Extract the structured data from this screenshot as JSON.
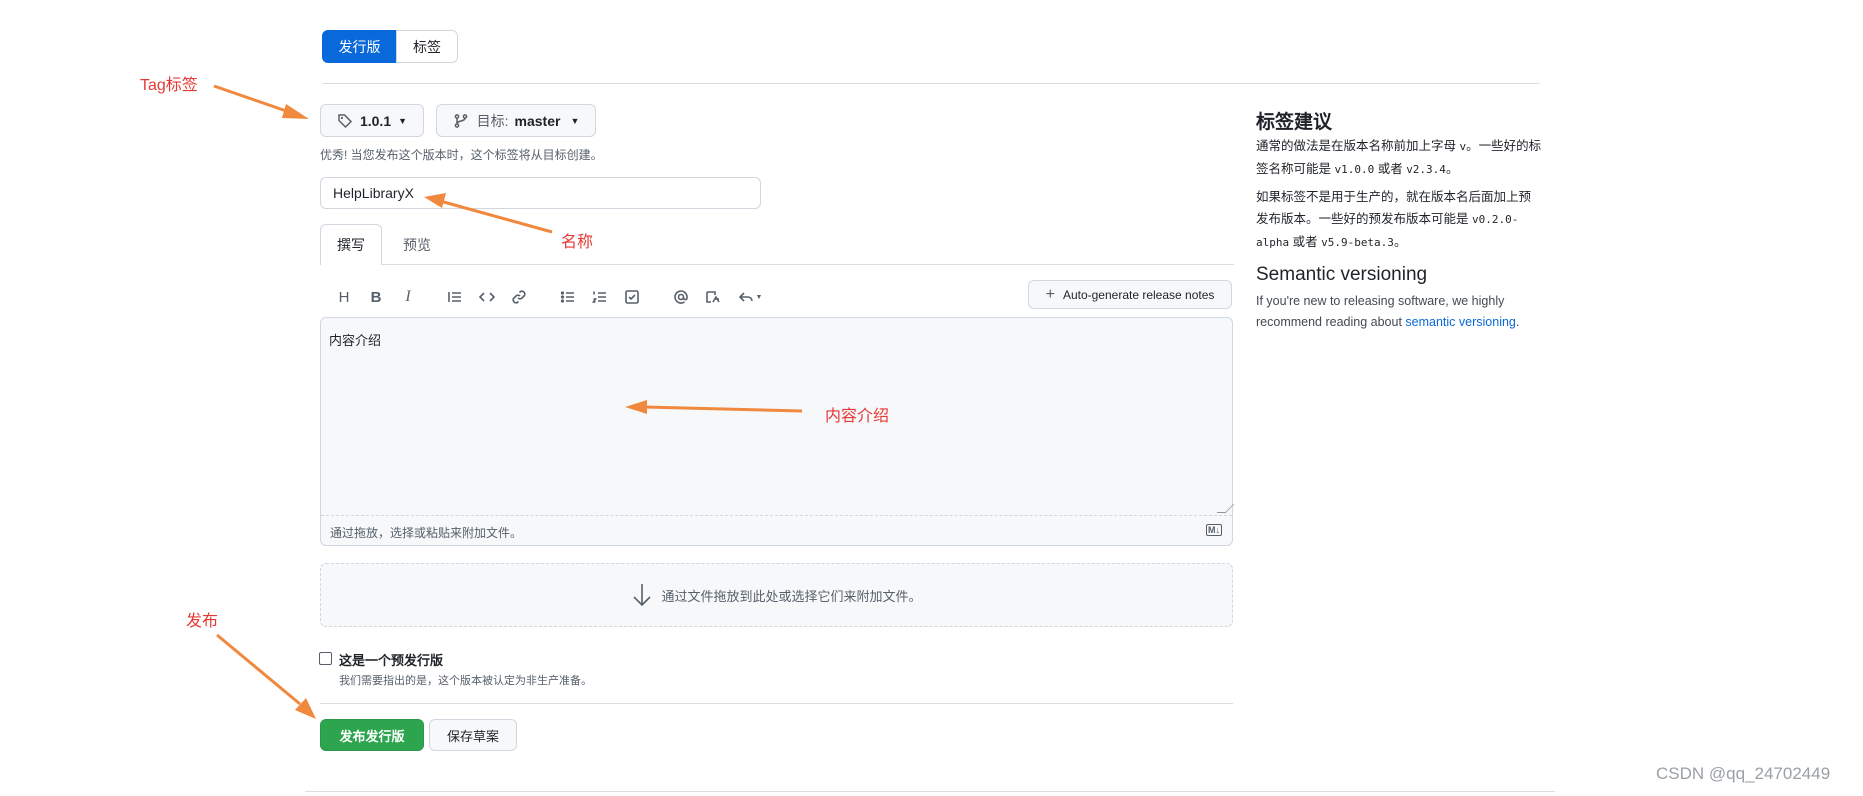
{
  "tabs": {
    "release_label": "发行版",
    "tags_label": "标签"
  },
  "form": {
    "tag_value": "1.0.1",
    "target_prefix": "目标:",
    "target_value": "master",
    "tag_hint": "优秀! 当您发布这个版本时，这个标签将从目标创建。",
    "title_value": "HelpLibraryX",
    "editor_tabs": {
      "write": "撰写",
      "preview": "预览"
    },
    "auto_generate_label": "Auto-generate release notes",
    "body_value": "内容介绍",
    "attach_hint": "通过拖放，选择或粘贴来附加文件。",
    "md_badge": "M↓",
    "dropzone_text": "通过文件拖放到此处或选择它们来附加文件。",
    "prerelease_label": "这是一个预发行版",
    "prerelease_desc": "我们需要指出的是，这个版本被认定为非生产准备。",
    "publish_label": "发布发行版",
    "draft_label": "保存草案"
  },
  "sidebar": {
    "tag_heading": "标签建议",
    "tag_p1_a": "通常的做法是在版本名称前加上字母 ",
    "tag_p1_code1": "v",
    "tag_p1_b": "。一些好的标签名称可能是 ",
    "tag_p1_code2": "v1.0.0",
    "tag_p1_c": " 或者 ",
    "tag_p1_code3": "v2.3.4",
    "tag_p1_d": "。",
    "tag_p2_a": "如果标签不是用于生产的，就在版本名后面加上预发布版本。一些好的预发布版本可能是 ",
    "tag_p2_code1": "v0.2.0-alpha",
    "tag_p2_b": " 或者 ",
    "tag_p2_code2": "v5.9-beta.3",
    "tag_p2_c": "。",
    "semver_heading": "Semantic versioning",
    "semver_text": "If you're new to releasing software, we highly recommend reading about ",
    "semver_link": "semantic versioning",
    "semver_end": "."
  },
  "annotations": {
    "tag": "Tag标签",
    "name": "名称",
    "content": "内容介绍",
    "publish": "发布"
  },
  "watermark": "CSDN @qq_24702449",
  "colors": {
    "primary_blue": "#0969da",
    "publish_green": "#2da44e",
    "annotation_red": "#e53935",
    "arrow_orange": "#f0883e"
  }
}
